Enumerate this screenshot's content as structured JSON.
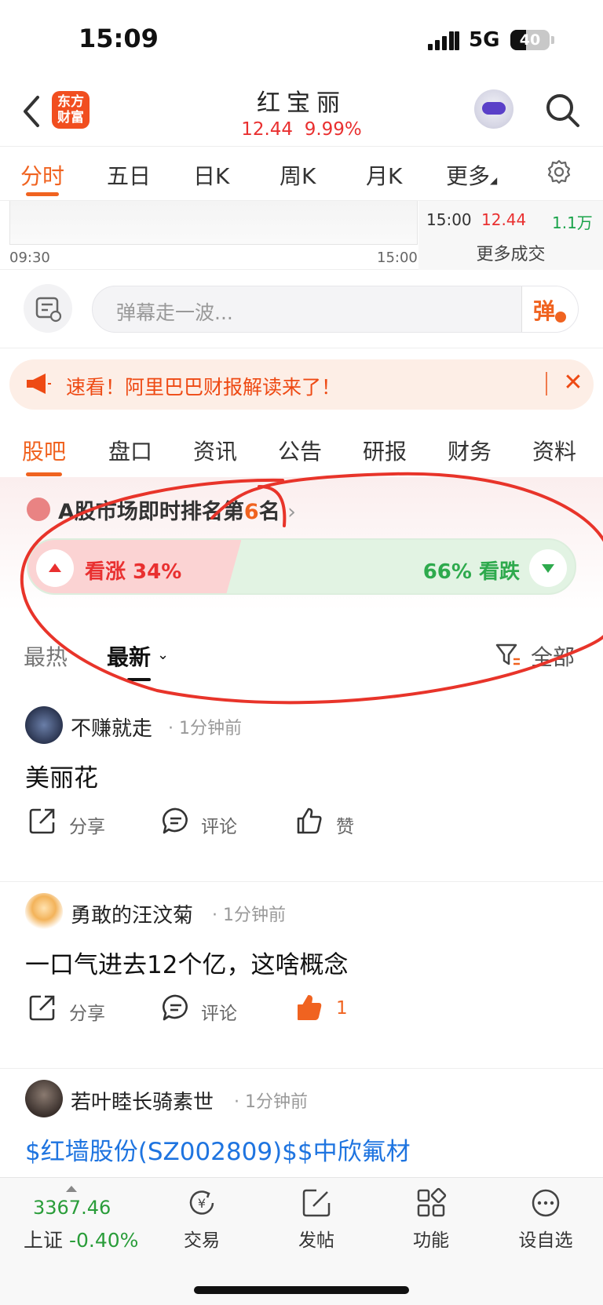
{
  "status_bar": {
    "time": "15:09",
    "network": "5G",
    "battery": "40",
    "battery_level": 0.4
  },
  "header": {
    "brand_line1": "东方",
    "brand_line2": "财富",
    "title": "红宝丽",
    "price": "12.44",
    "change": "9.99%"
  },
  "chart_tabs": [
    "分时",
    "五日",
    "日K",
    "周K",
    "月K",
    "更多"
  ],
  "mini_chart": {
    "start_time": "09:30",
    "end_time": "15:00",
    "trade": {
      "time": "15:00",
      "price": "12.44",
      "volume": "1.1万"
    },
    "more_deals": "更多成交"
  },
  "danmu": {
    "placeholder": "弹幕走一波...",
    "send_label": "弹"
  },
  "banner": {
    "text": "速看！阿里巴巴财报解读来了！",
    "close": "✕"
  },
  "content_tabs": [
    "股吧",
    "盘口",
    "资讯",
    "公告",
    "研报",
    "财务",
    "资料"
  ],
  "sentiment": {
    "rank_prefix": "A股市场即时排名第",
    "rank_number": "6",
    "rank_suffix": "名",
    "rank_chevron": "›",
    "bull_label": "看涨 34%",
    "bear_label": "66% 看跌",
    "bull_fraction": 0.34
  },
  "sort": {
    "hot": "最热",
    "new": "最新",
    "filter": "全部"
  },
  "posts": [
    {
      "author": "不赚就走",
      "time": "· 1分钟前",
      "body": "美丽花",
      "share": "分享",
      "comment": "评论",
      "like": "赞",
      "liked": false
    },
    {
      "author": "勇敢的汪汶菊",
      "time": "· 1分钟前",
      "body": "一口气进去12个亿，这啥概念",
      "share": "分享",
      "comment": "评论",
      "like": "1",
      "liked": true
    },
    {
      "author": "若叶睦长骑素世",
      "time": "· 1分钟前",
      "body": "$红墙股份(SZ002809)$$中欣氟材"
    }
  ],
  "bottom_bar": {
    "index_value": "3367.46",
    "index_name": "上证",
    "index_change": "-0.40%",
    "items": [
      "交易",
      "发帖",
      "功能",
      "设自选"
    ]
  },
  "colors": {
    "accent": "#f06320",
    "up": "#e93030",
    "down": "#2eaa4d",
    "link": "#1e74e0"
  }
}
